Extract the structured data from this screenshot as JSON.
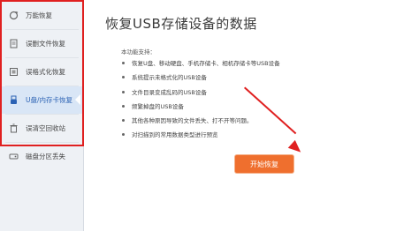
{
  "sidebar": {
    "items": [
      {
        "label": "万能恢复",
        "icon": "refresh-icon",
        "active": false
      },
      {
        "label": "误删文件恢复",
        "icon": "file-icon",
        "active": false
      },
      {
        "label": "误格式化恢复",
        "icon": "format-icon",
        "active": false
      },
      {
        "label": "U盘/内存卡恢复",
        "icon": "usb-icon",
        "active": true
      },
      {
        "label": "误清空回收站",
        "icon": "recycle-bin-icon",
        "active": false
      },
      {
        "label": "磁盘分区丢失",
        "icon": "disk-icon",
        "active": false
      }
    ]
  },
  "main": {
    "title": "恢复USB存储设备的数据",
    "intro": "本功能支持：",
    "features": [
      "恢复U盘、移动硬盘、手机存储卡、相机存储卡等USB设备",
      "系统提示未格式化的USB设备",
      "文件目录变成乱码的USB设备",
      "频繁掉盘的USB设备",
      "其他各种原因导致的文件丢失、打不开等问题。",
      "对扫描到的常用数据类型进行预览"
    ],
    "start_button": "开始恢复"
  },
  "colors": {
    "accent_button": "#ef6f2e",
    "highlight_frame": "#e02020",
    "active_item": "#2b62b4"
  }
}
